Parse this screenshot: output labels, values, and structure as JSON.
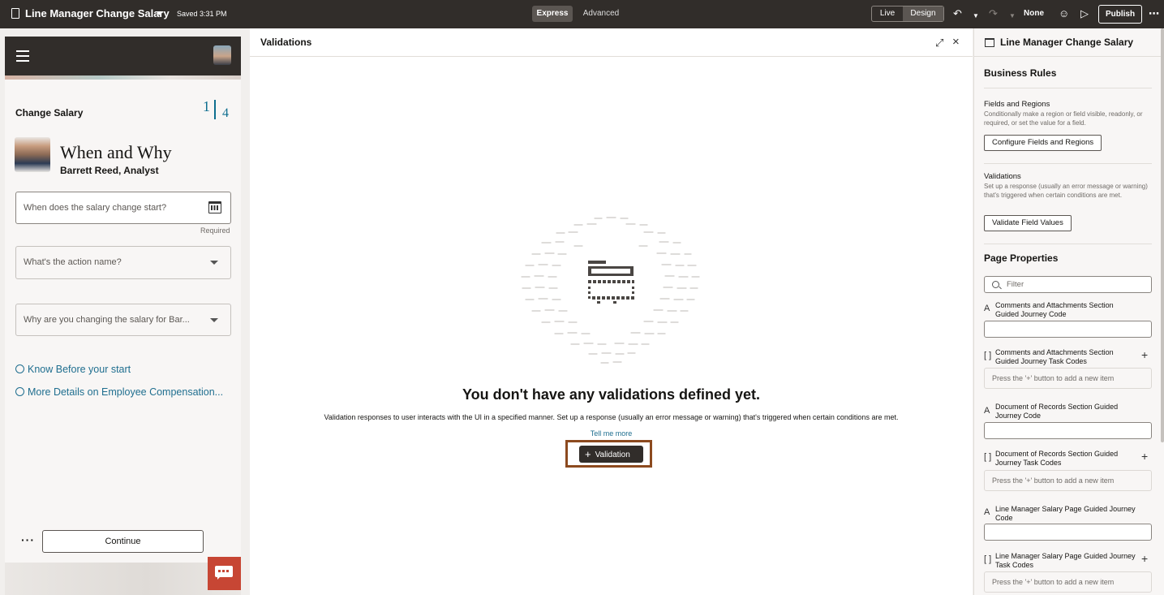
{
  "topbar": {
    "title": "Line Manager Change Salary",
    "saved": "Saved 3:31 PM",
    "mode_express": "Express",
    "mode_advanced": "Advanced",
    "live": "Live",
    "design": "Design",
    "none": "None",
    "publish": "Publish"
  },
  "phone": {
    "page_title": "Change Salary",
    "step_current": "1",
    "step_total": "4",
    "heading": "When and Why",
    "person": "Barrett Reed, Analyst",
    "field_start_placeholder": "When does the salary change start?",
    "required": "Required",
    "field_action_placeholder": "What's the action name?",
    "field_reason_placeholder": "Why are you changing the salary for Bar...",
    "link_know": "Know Before your start",
    "link_more": "More Details on Employee Compensation...",
    "continue": "Continue"
  },
  "center": {
    "title": "Validations",
    "empty_title": "You don't have any validations defined yet.",
    "empty_desc": "Validation responses to user interacts with the UI in a specified manner. Set up a response (usually an error message or warning) that's triggered when certain conditions are met.",
    "tell_more": "Tell me more",
    "add_button": "Validation"
  },
  "right": {
    "title": "Line Manager Change Salary",
    "business_rules": "Business Rules",
    "fields_regions_title": "Fields and Regions",
    "fields_regions_help": "Conditionally make a region or field visible, readonly, or required, or set the value for a field.",
    "configure_button": "Configure Fields and Regions",
    "validations_title": "Validations",
    "validations_help": "Set up a response (usually an error message or warning) that's triggered when certain conditions are met.",
    "validate_button": "Validate Field Values",
    "page_properties": "Page Properties",
    "filter_placeholder": "Filter",
    "props": [
      {
        "label": "Comments and Attachments Section Guided Journey Code",
        "kind": "text"
      },
      {
        "label": "Comments and Attachments Section Guided Journey Task Codes",
        "kind": "list",
        "empty": "Press the '+' button to add a new item"
      },
      {
        "label": "Document of Records Section Guided Journey Code",
        "kind": "text"
      },
      {
        "label": "Document of Records Section Guided Journey Task Codes",
        "kind": "list",
        "empty": "Press the '+' button to add a new item"
      },
      {
        "label": "Line Manager Salary Page Guided Journey Code",
        "kind": "text"
      },
      {
        "label": "Line Manager Salary Page Guided Journey Task Codes",
        "kind": "list",
        "empty": "Press the '+' button to add a new item"
      }
    ]
  }
}
